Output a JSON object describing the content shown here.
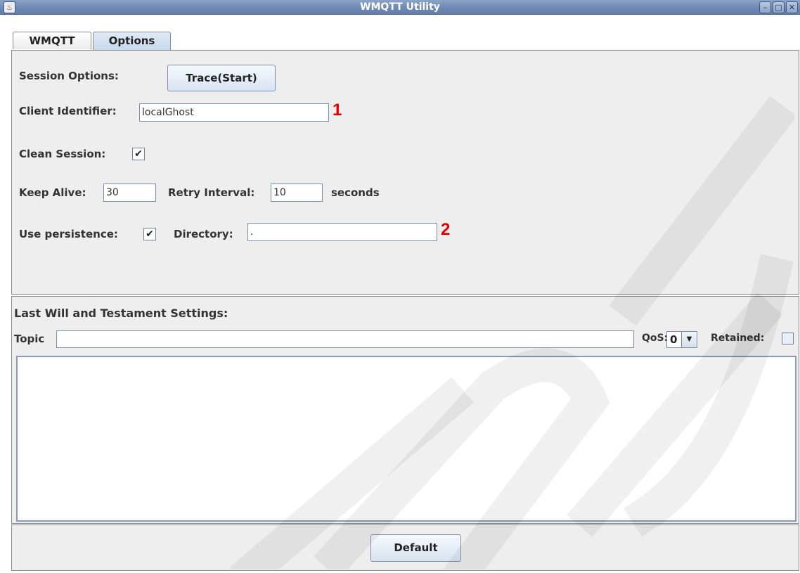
{
  "window": {
    "title": "WMQTT Utility",
    "app_icon_glyph": "♨",
    "controls": [
      "minimize-icon",
      "maximize-icon",
      "close-icon"
    ],
    "min_glyph": "–",
    "max_glyph": "□",
    "close_glyph": "✕"
  },
  "tabs": [
    {
      "label": "WMQTT",
      "selected": false
    },
    {
      "label": "Options",
      "selected": true
    }
  ],
  "session": {
    "label": "Session Options:",
    "trace_button": "Trace(Start)",
    "client_id_label": "Client Identifier:",
    "client_id_value": "localGhost",
    "clean_session_label": "Clean Session:",
    "clean_session_checked": true,
    "keep_alive_label": "Keep Alive:",
    "keep_alive_value": "30",
    "retry_label": "Retry Interval:",
    "retry_value": "10",
    "seconds_label": "seconds",
    "persistence_label": "Use persistence:",
    "persistence_checked": true,
    "directory_label": "Directory:",
    "directory_value": "."
  },
  "annotations": {
    "marker_1": "1",
    "marker_2": "2"
  },
  "lwt": {
    "title": "Last Will and Testament Settings:",
    "topic_label": "Topic",
    "topic_value": "",
    "qos_label": "QoS:",
    "qos_value": "0",
    "qos_arrow": "▼",
    "retained_label": "Retained:",
    "retained_checked": false,
    "message_value": ""
  },
  "footer": {
    "default_button": "Default"
  },
  "check_glyph": "✔",
  "colors": {
    "titlebar": "#6f8bb4",
    "annotation": "#e00000",
    "panel_bg": "#eeeeee"
  }
}
